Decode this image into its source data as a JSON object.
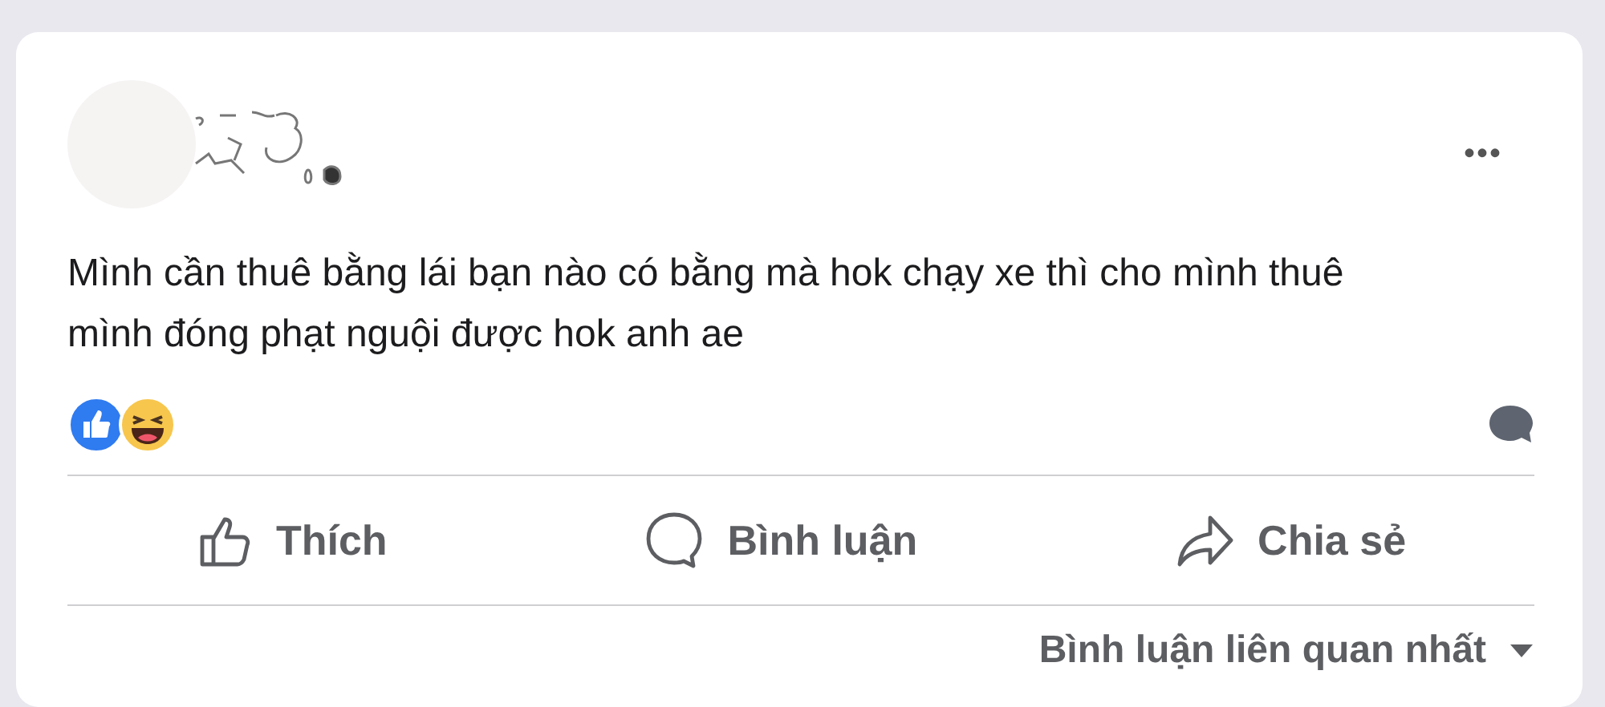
{
  "post": {
    "text": "Mình cần thuê bằng lái bạn nào có bằng mà hok chạy xe thì cho mình thuê mình đóng phạt nguội được hok anh ae",
    "menu": "•••"
  },
  "reactions": [
    {
      "kind": "like"
    },
    {
      "kind": "haha"
    }
  ],
  "actions": [
    {
      "kind": "like",
      "label": "Thích"
    },
    {
      "kind": "comment",
      "label": "Bình luận"
    },
    {
      "kind": "share",
      "label": "Chia sẻ"
    }
  ],
  "sort": {
    "label": "Bình luận liên quan nhất"
  }
}
